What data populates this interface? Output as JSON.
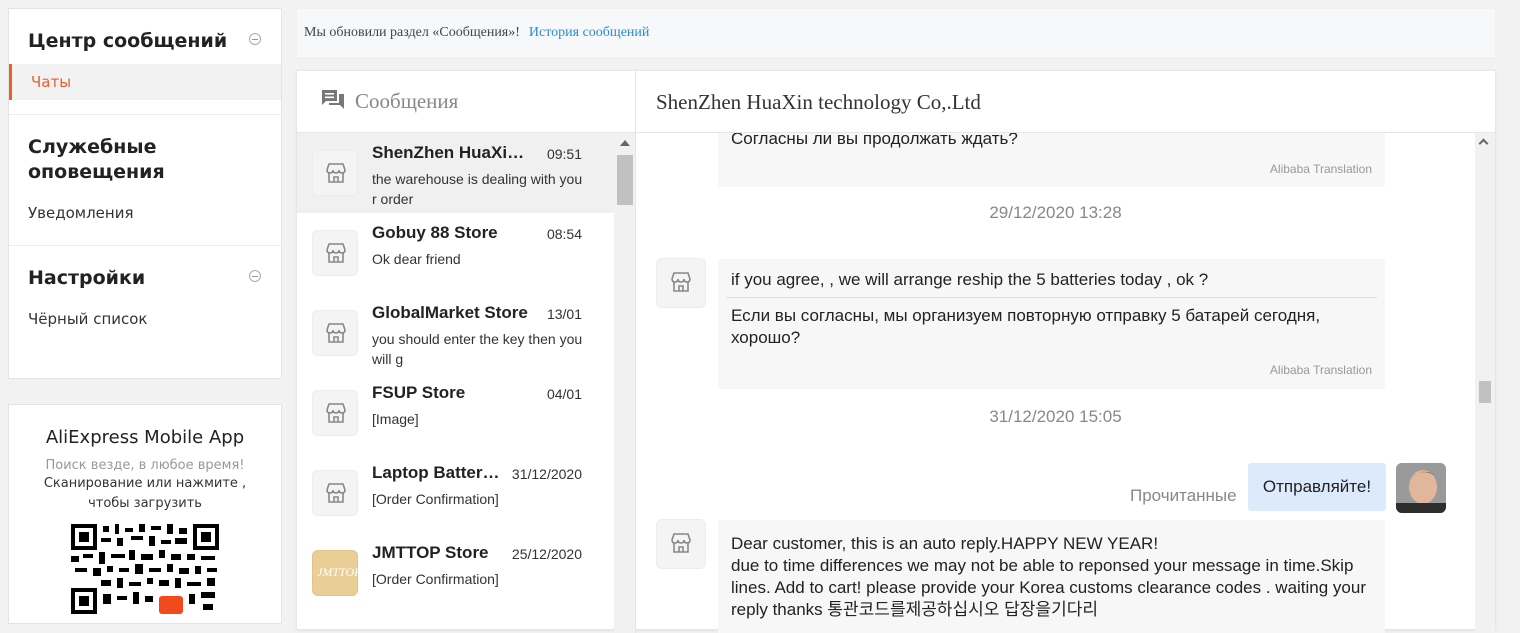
{
  "sidebar": {
    "message_center": {
      "title": "Центр сообщений",
      "items": [
        {
          "label": "Чаты"
        }
      ]
    },
    "service": {
      "title": "Служебные оповещения",
      "items": [
        {
          "label": "Уведомления"
        }
      ]
    },
    "settings": {
      "title": "Настройки",
      "items": [
        {
          "label": "Чёрный список"
        }
      ]
    }
  },
  "app_promo": {
    "title": "AliExpress Mobile App",
    "subtitle": "Поиск везде, в любое время!",
    "desc": "Сканирование или нажмите , чтобы загрузить"
  },
  "banner": {
    "text": "Мы обновили раздел «Сообщения»!",
    "link": "История сообщений"
  },
  "list_header": {
    "title": "Сообщения"
  },
  "conversations": [
    {
      "name": "ShenZhen HuaXin technology Co,.Ltd",
      "time": "09:51",
      "preview": "the warehouse is dealing with your order",
      "active": true
    },
    {
      "name": "Gobuy 88 Store",
      "time": "08:54",
      "preview": "Ok dear friend"
    },
    {
      "name": "GlobalMarket Store",
      "time": "13/01",
      "preview": "you should enter the key then you will g"
    },
    {
      "name": "FSUP Store",
      "time": "04/01",
      "preview": "[Image]"
    },
    {
      "name": "Laptop Battery Store",
      "time": "31/12/2020",
      "preview": "[Order Confirmation]"
    },
    {
      "name": "JMTTOP Store",
      "time": "25/12/2020",
      "preview": "[Order Confirmation]",
      "avatar_text": "JMTTOP"
    }
  ],
  "chat": {
    "header": "ShenZhen HuaXin technology Co,.Ltd",
    "msg1": {
      "translation": "Согласны ли вы продолжать ждать?",
      "source": "Alibaba Translation"
    },
    "stamp1": "29/12/2020 13:28",
    "msg2": {
      "original": "if  you agree, , we will arrange reship the 5 batteries today ,  ok ?",
      "translation": "Если вы согласны, мы организуем повторную отправку 5 батарей сегодня, хорошо?",
      "source": "Alibaba Translation"
    },
    "stamp2": "31/12/2020 15:05",
    "sent": {
      "text": "Отправляйте!",
      "status": "Прочитанные"
    },
    "msg3": {
      "text": "Dear customer, this is an auto reply.HAPPY NEW YEAR!\ndue to time differences we may not be able to reponsed your message in time.Skip lines. Add to cart!  please provide  your Korea customs clearance codes . waiting your  reply  thanks  통관코드를제공하십시오  답장을기다리"
    }
  }
}
